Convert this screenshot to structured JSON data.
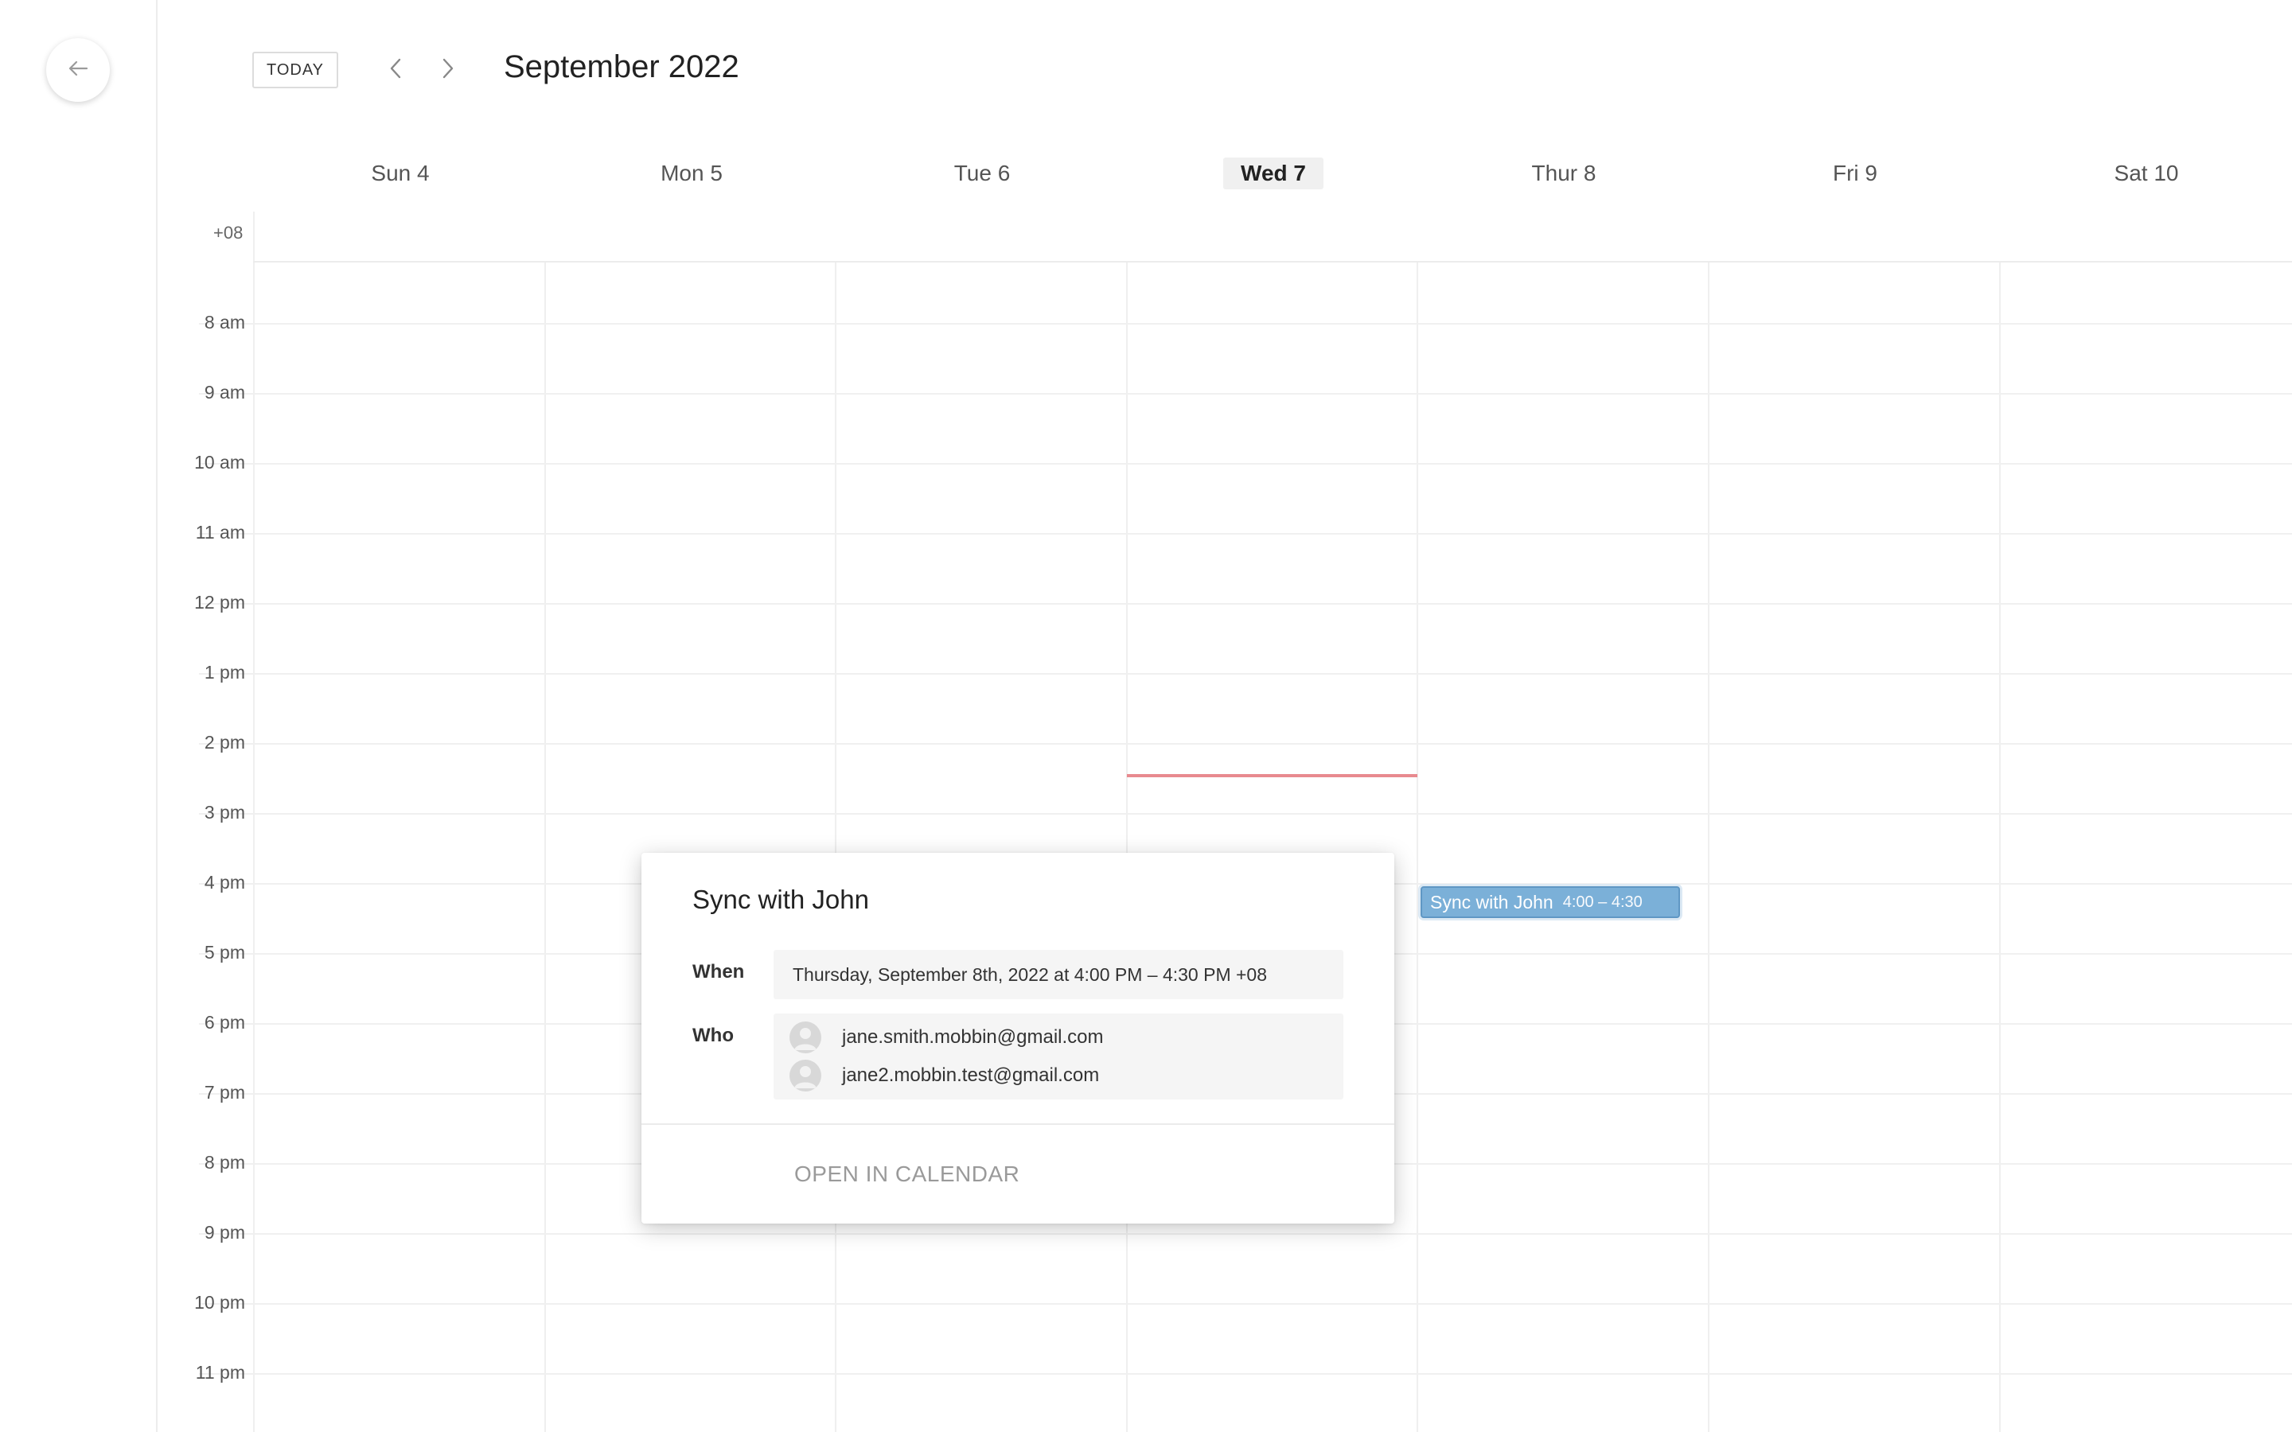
{
  "toolbar": {
    "today_label": "TODAY",
    "month_title": "September 2022"
  },
  "days": [
    {
      "label": "Sun 4",
      "today": false
    },
    {
      "label": "Mon 5",
      "today": false
    },
    {
      "label": "Tue 6",
      "today": false
    },
    {
      "label": "Wed 7",
      "today": true
    },
    {
      "label": "Thur 8",
      "today": false
    },
    {
      "label": "Fri 9",
      "today": false
    },
    {
      "label": "Sat 10",
      "today": false
    }
  ],
  "timezone_label": "+08",
  "hours": [
    "8 am",
    "9 am",
    "10 am",
    "11 am",
    "12 pm",
    "1 pm",
    "2 pm",
    "3 pm",
    "4 pm",
    "5 pm",
    "6 pm",
    "7 pm",
    "8 pm",
    "9 pm",
    "10 pm",
    "11 pm"
  ],
  "event_chip": {
    "title": "Sync with John",
    "time": "4:00 – 4:30"
  },
  "popover": {
    "title": "Sync with John",
    "when_label": "When",
    "when_value": "Thursday, September 8th, 2022 at 4:00 PM – 4:30 PM +08",
    "who_label": "Who",
    "guests": [
      "jane.smith.mobbin@gmail.com",
      "jane2.mobbin.test@gmail.com"
    ],
    "open_label": "OPEN IN CALENDAR"
  },
  "colors": {
    "event_fill": "#7bb0d8",
    "now_line": "#e88a8f",
    "today_bg": "#f0f0f0"
  },
  "icons": {
    "back": "arrow-left-icon",
    "prev": "chevron-left-icon",
    "next": "chevron-right-icon",
    "avatar": "user-avatar-icon"
  }
}
